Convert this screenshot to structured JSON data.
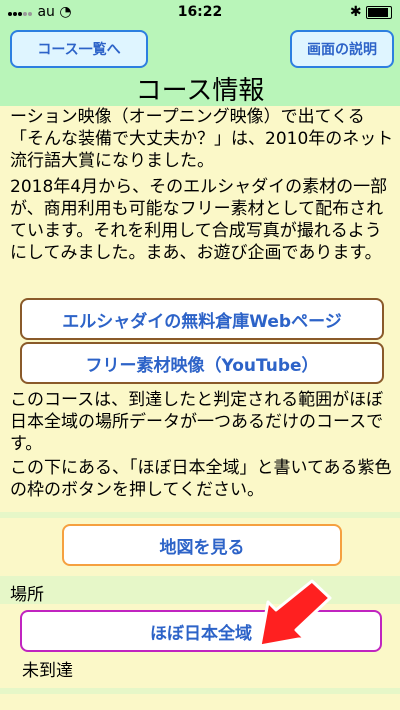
{
  "status_bar": {
    "carrier": "au",
    "time": "16:22"
  },
  "header": {
    "back_button": "コース一覧へ",
    "help_button": "画面の説明",
    "title": "コース情報"
  },
  "body": {
    "paragraph1": "ーション映像（オープニング映像）で出てくる「そんな装備で大丈夫か？」は、2010年のネット流行語大賞になりました。",
    "paragraph2": "2018年4月から、そのエルシャダイの素材の一部が、商用利用も可能なフリー素材として配布されています。それを利用して合成写真が撮れるようにしてみました。まあ、お遊び企画であります。",
    "link1": "エルシャダイの無料倉庫Webページ",
    "link2": "フリー素材映像（YouTube）",
    "paragraph3": "このコースは、到達したと判定される範囲がほぼ日本全域の場所データが一つあるだけのコースです。",
    "paragraph4": "この下にある、「ほぼ日本全域」と書いてある紫色の枠のボタンを押してください。",
    "map_button": "地図を見る",
    "place_label": "場所",
    "place_button": "ほぼ日本全域",
    "place_status": "未到達"
  },
  "colors": {
    "header_bg": "#b9f5b9",
    "page_bg": "#fbf8c8",
    "link_text": "#2d63c8",
    "place_border": "#c024c0",
    "arrow": "#ff2020"
  }
}
